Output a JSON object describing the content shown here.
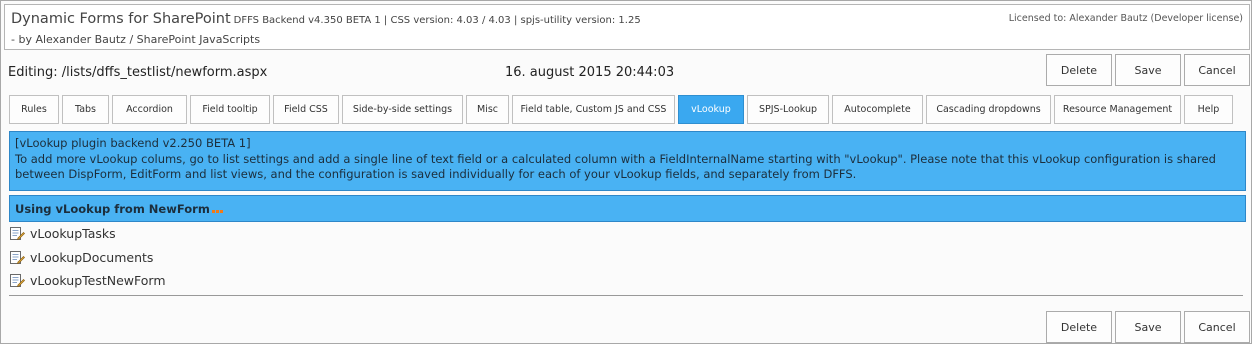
{
  "header": {
    "app_title": "Dynamic Forms for SharePoint",
    "app_meta": "DFFS Backend v4.350 BETA 1 | CSS version: 4.03 / 4.03 | spjs-utility version: 1.25",
    "byline": "- by Alexander Bautz / SharePoint JavaScripts",
    "license": "Licensed to: Alexander Bautz (Developer license)"
  },
  "editing": {
    "label": "Editing: /lists/dffs_testlist/newform.aspx",
    "datetime": "16. august 2015 20:44:03"
  },
  "actions": {
    "delete": "Delete",
    "save": "Save",
    "cancel": "Cancel"
  },
  "tabs": [
    {
      "label": "Rules"
    },
    {
      "label": "Tabs"
    },
    {
      "label": "Accordion"
    },
    {
      "label": "Field tooltip"
    },
    {
      "label": "Field CSS"
    },
    {
      "label": "Side-by-side settings"
    },
    {
      "label": "Misc"
    },
    {
      "label": "Field table, Custom JS and CSS"
    },
    {
      "label": "vLookup"
    },
    {
      "label": "SPJS-Lookup"
    },
    {
      "label": "Autocomplete"
    },
    {
      "label": "Cascading dropdowns"
    },
    {
      "label": "Resource Management"
    },
    {
      "label": "Help"
    }
  ],
  "active_tab": "vLookup",
  "plugin": {
    "version_line": "[vLookup plugin backend v2.250 BETA 1]",
    "description_line1": "To add more vLookup colums, go to list settings and add a single line of text field or a calculated column with a FieldInternalName starting with \"vLookup\". Please note that this vLookup configuration is shared",
    "description_line2": "between DispForm, EditForm and list views, and the configuration is saved individually for each of your vLookup fields, and separately from DFFS."
  },
  "section": {
    "title": "Using vLookup from NewForm"
  },
  "fields": [
    {
      "label": "vLookupTasks",
      "icon": "edit-icon"
    },
    {
      "label": "vLookupDocuments",
      "icon": "edit-icon"
    },
    {
      "label": "vLookupTestNewForm",
      "icon": "edit-icon"
    }
  ],
  "colors": {
    "accent": "#49b2f3",
    "active_tab": "#3aa8f0",
    "dots": "#f07a18"
  }
}
